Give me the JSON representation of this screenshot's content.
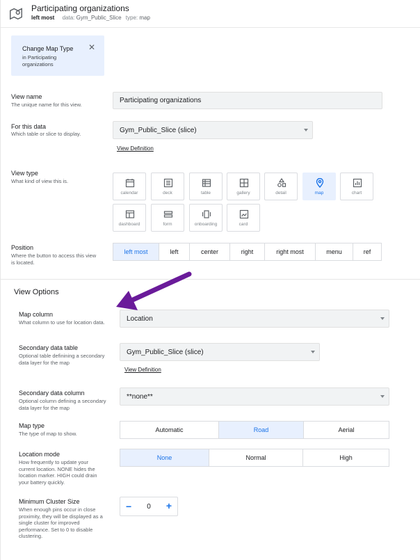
{
  "header": {
    "title": "Participating organizations",
    "position_value": "left most",
    "data_key": "data:",
    "data_value": "Gym_Public_Slice",
    "type_key": "type:",
    "type_value": "map"
  },
  "info_box": {
    "title": "Change Map Type",
    "subtitle": "in Participating organizations"
  },
  "view_name": {
    "label": "View name",
    "description": "The unique name for this view.",
    "value": "Participating organizations"
  },
  "for_this_data": {
    "label": "For this data",
    "description": "Which table or slice to display.",
    "value": "Gym_Public_Slice (slice)",
    "link": "View Definition"
  },
  "view_type": {
    "label": "View type",
    "description": "What kind of view this is.",
    "tiles": [
      {
        "label": "calendar",
        "icon": "calendar-icon"
      },
      {
        "label": "deck",
        "icon": "deck-icon"
      },
      {
        "label": "table",
        "icon": "table-icon"
      },
      {
        "label": "gallery",
        "icon": "gallery-icon"
      },
      {
        "label": "detail",
        "icon": "detail-icon"
      },
      {
        "label": "map",
        "icon": "map-pin-icon"
      },
      {
        "label": "chart",
        "icon": "chart-icon"
      },
      {
        "label": "dashboard",
        "icon": "dashboard-icon"
      },
      {
        "label": "form",
        "icon": "form-icon"
      },
      {
        "label": "onboarding",
        "icon": "onboarding-icon"
      },
      {
        "label": "card",
        "icon": "card-icon"
      }
    ],
    "selected": "map"
  },
  "position": {
    "label": "Position",
    "description": "Where the button to access this view is located.",
    "options": [
      "left most",
      "left",
      "center",
      "right",
      "right most",
      "menu",
      "ref"
    ],
    "selected": "left most"
  },
  "view_options": {
    "title": "View Options",
    "map_column": {
      "label": "Map column",
      "description": "What column to use for location data.",
      "value": "Location"
    },
    "secondary_table": {
      "label": "Secondary data table",
      "description": "Optional table definining a secondary data layer for the map",
      "value": "Gym_Public_Slice (slice)",
      "link": "View Definition"
    },
    "secondary_column": {
      "label": "Secondary data column",
      "description": "Optional column defining a secondary data layer for the map",
      "value": "**none**"
    },
    "map_type": {
      "label": "Map type",
      "description": "The type of map to show.",
      "options": [
        "Automatic",
        "Road",
        "Aerial"
      ],
      "selected": "Road"
    },
    "location_mode": {
      "label": "Location mode",
      "description": "How frequently to update your current location. NONE hides the location marker. HIGH could drain your battery quickly.",
      "options": [
        "None",
        "Normal",
        "High"
      ],
      "selected": "None"
    },
    "min_cluster": {
      "label": "Minimum Cluster Size",
      "description": "When enough pins occur in close proximity, they will be displayed as a single cluster for improved performance. Set to 0 to disable clustering.",
      "value": "0",
      "minus": "−",
      "plus": "+"
    }
  },
  "colors": {
    "accent": "#1a73e8",
    "selected_bg": "#e8f0fe",
    "arrow": "#6a1b9a"
  }
}
